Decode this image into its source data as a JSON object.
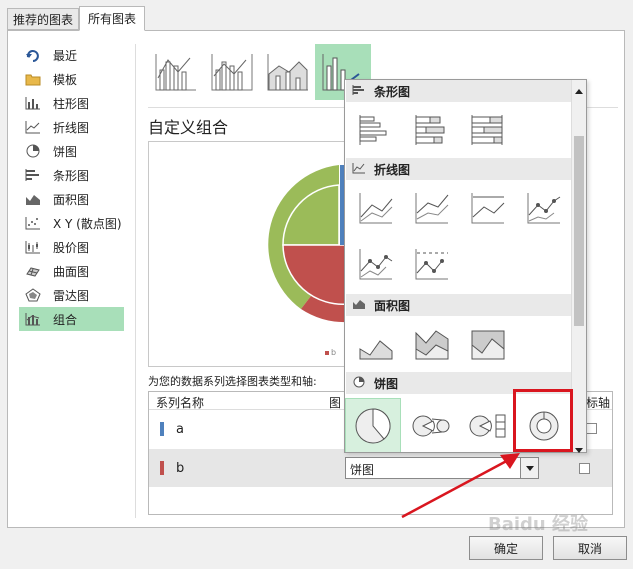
{
  "tabs": [
    {
      "label": "推荐的图表"
    },
    {
      "label": "所有图表"
    }
  ],
  "sidebar": {
    "items": [
      {
        "label": "最近",
        "icon": "recent-icon"
      },
      {
        "label": "模板",
        "icon": "folder-icon"
      },
      {
        "label": "柱形图",
        "icon": "column-chart-icon"
      },
      {
        "label": "折线图",
        "icon": "line-chart-icon"
      },
      {
        "label": "饼图",
        "icon": "pie-chart-icon"
      },
      {
        "label": "条形图",
        "icon": "bar-chart-icon"
      },
      {
        "label": "面积图",
        "icon": "area-chart-icon"
      },
      {
        "label": "X Y (散点图)",
        "icon": "scatter-chart-icon"
      },
      {
        "label": "股价图",
        "icon": "stock-chart-icon"
      },
      {
        "label": "曲面图",
        "icon": "surface-chart-icon"
      },
      {
        "label": "雷达图",
        "icon": "radar-chart-icon"
      },
      {
        "label": "组合",
        "icon": "combo-chart-icon"
      }
    ],
    "selected": "组合"
  },
  "main": {
    "section_title": "自定义组合",
    "series_prompt": "为您的数据系列选择图表类型和轴:",
    "columns": {
      "name": "系列名称",
      "type": "图",
      "axis": "标轴"
    },
    "series": [
      {
        "name": "a",
        "color": "#4f81bd",
        "type": ""
      },
      {
        "name": "b",
        "color": "#c0504d",
        "type": "饼图"
      }
    ],
    "legend_snippet": "b"
  },
  "dropdown": {
    "sections": [
      {
        "title": "条形图",
        "icon": "bar-chart-icon"
      },
      {
        "title": "折线图",
        "icon": "line-chart-icon"
      },
      {
        "title": "面积图",
        "icon": "area-chart-icon"
      },
      {
        "title": "饼图",
        "icon": "pie-chart-icon"
      }
    ]
  },
  "buttons": {
    "ok": "确定",
    "cancel": "取消"
  },
  "watermark": "Baidu 经验",
  "colors": {
    "accent_green": "#a8dfb9",
    "highlight_red": "#d9161f",
    "pie_green": "#9bbb59",
    "pie_red": "#c0504d",
    "pie_blue": "#4f81bd"
  }
}
